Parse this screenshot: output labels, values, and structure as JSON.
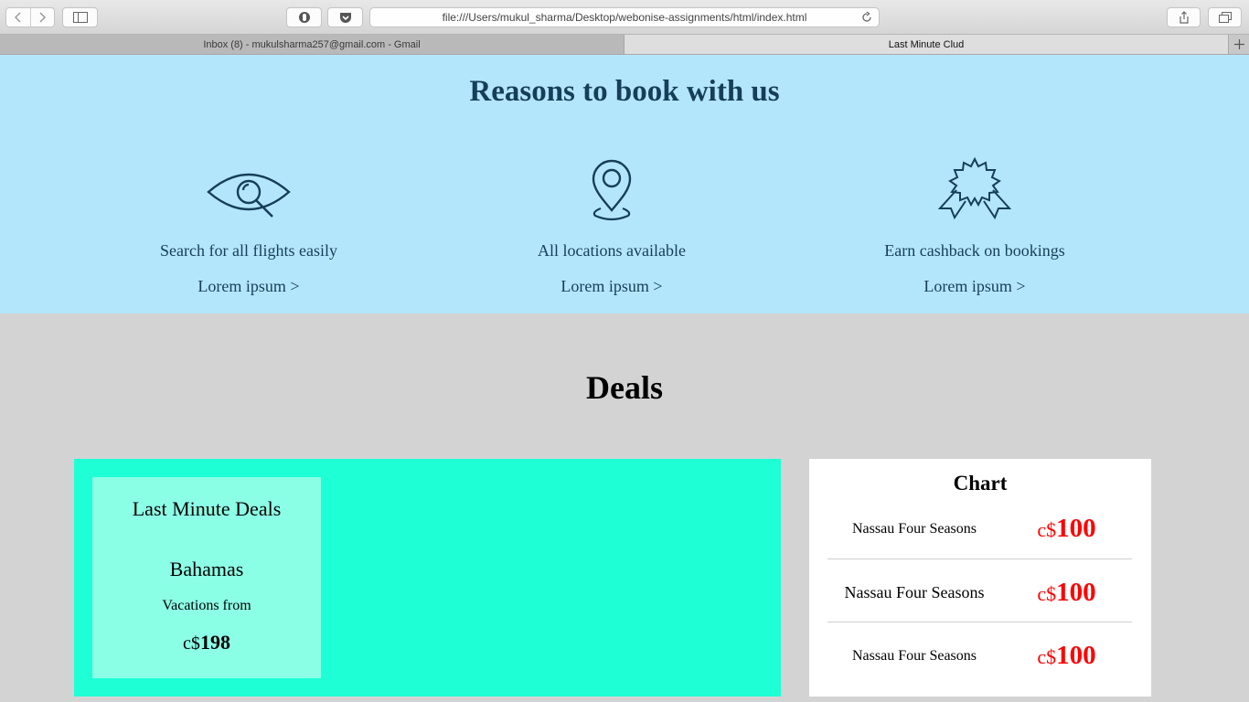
{
  "browser": {
    "url": "file:///Users/mukul_sharma/Desktop/webonise-assignments/html/index.html",
    "tabs": [
      {
        "label": "Inbox (8) - mukulsharma257@gmail.com - Gmail",
        "active": false
      },
      {
        "label": "Last Minute Clud",
        "active": true
      }
    ]
  },
  "reasons": {
    "title": "Reasons to book with us",
    "features": [
      {
        "icon": "eye-search-icon",
        "text": "Search for all flights easily",
        "link": "Lorem ipsum >"
      },
      {
        "icon": "location-pin-icon",
        "text": "All locations available",
        "link": "Lorem ipsum >"
      },
      {
        "icon": "award-badge-icon",
        "text": "Earn cashback on bookings",
        "link": "Lorem ipsum >"
      }
    ]
  },
  "deals": {
    "title": "Deals",
    "card": {
      "title": "Last Minute Deals",
      "destination": "Bahamas",
      "subtitle": "Vacations from",
      "currency": "c$",
      "price": "198"
    },
    "chart": {
      "title": "Chart",
      "rows": [
        {
          "name": "Nassau Four Seasons",
          "currency": "c$",
          "amount": "100"
        },
        {
          "name": "Nassau Four Seasons",
          "currency": "c$",
          "amount": "100"
        },
        {
          "name": "Nassau Four Seasons",
          "currency": "c$",
          "amount": "100"
        }
      ]
    }
  },
  "colors": {
    "reasons_bg": "#b4e6fb",
    "reasons_text": "#163e59",
    "deal_panel": "#1effd6",
    "deal_card": "#8cffe7",
    "price_red": "#ff0000",
    "page_bg": "#d3d3d3"
  }
}
